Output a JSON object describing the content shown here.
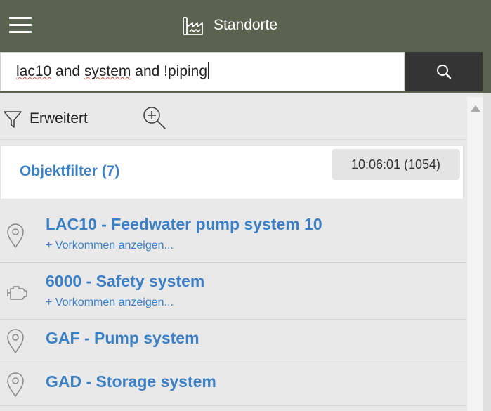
{
  "header": {
    "title": "Standorte",
    "menu_icon": "hamburger-menu-icon",
    "title_icon": "factory-icon",
    "background_color": "#5a6350"
  },
  "search": {
    "value_parts": [
      "lac10",
      " and ",
      "system",
      " and ",
      "!piping"
    ],
    "button_icon": "search-icon"
  },
  "toolbar": {
    "advanced_label": "Erweitert",
    "advanced_icon": "filter-funnel-icon",
    "zoom_icon": "zoom-in-icon"
  },
  "filter_card": {
    "title": "Objektfilter (7)",
    "timestamp": "10:06:01 (1054)"
  },
  "items": [
    {
      "title": "LAC10 - Feedwater pump system 10",
      "subtitle": "+ Vorkommen anzeigen...",
      "icon": "location-pin-icon"
    },
    {
      "title": "6000 - Safety system",
      "subtitle": "+ Vorkommen anzeigen...",
      "icon": "engine-icon"
    },
    {
      "title": "GAF - Pump system",
      "subtitle": "",
      "icon": "location-pin-icon"
    },
    {
      "title": "GAD - Storage system",
      "subtitle": "",
      "icon": "location-pin-icon"
    }
  ],
  "colors": {
    "accent": "#3b7fc4",
    "search_button": "#353535"
  }
}
